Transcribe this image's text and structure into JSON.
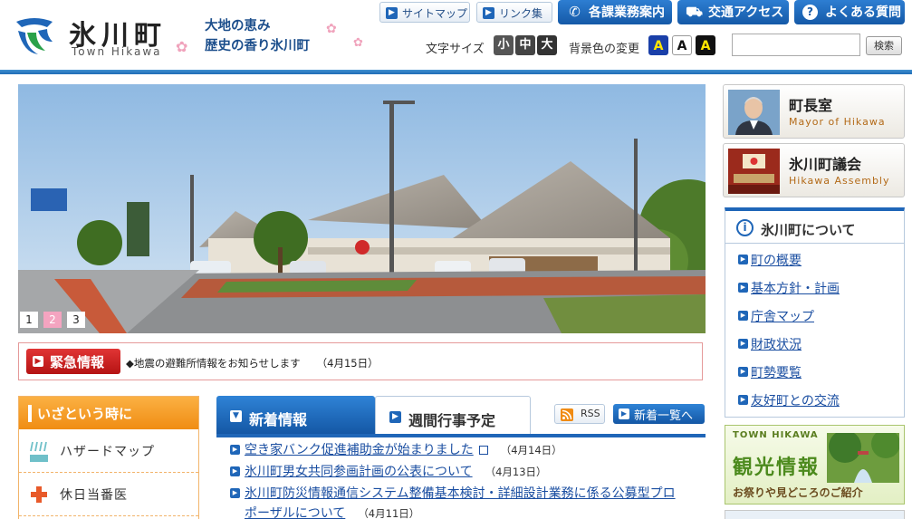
{
  "site": {
    "title": "氷川町",
    "title_en": "Town Hikawa",
    "tagline_1": "大地の恵み",
    "tagline_2": "歴史の香り氷川町"
  },
  "header_links": {
    "sitemap": "サイトマップ",
    "links": "リンク集"
  },
  "top_nav": [
    {
      "label": "各課業務案内",
      "icon": "phone-icon"
    },
    {
      "label": "交通アクセス",
      "icon": "car-icon"
    },
    {
      "label": "よくある質問",
      "icon": "question-icon"
    }
  ],
  "font_size": {
    "label": "文字サイズ",
    "small": "小",
    "medium": "中",
    "large": "大"
  },
  "bg_color": {
    "label": "背景色の変更",
    "options": [
      "A",
      "A",
      "A"
    ]
  },
  "search": {
    "placeholder": "",
    "button": "検索"
  },
  "slideshow": {
    "dots": [
      "1",
      "2",
      "3"
    ],
    "active": 2
  },
  "emergency": {
    "badge": "緊急情報",
    "text": "◆地震の避難所情報をお知らせします",
    "date": "（4月15日）"
  },
  "in_emergency": {
    "title": "いざという時に",
    "items": [
      {
        "label": "ハザードマップ",
        "icon": "rain-icon"
      },
      {
        "label": "休日当番医",
        "icon": "medical-cross-icon"
      }
    ]
  },
  "news": {
    "tab_news": "新着情報",
    "tab_weekly": "週間行事予定",
    "rss": "RSS",
    "list_button": "新着一覧へ",
    "items": [
      {
        "title": "空き家バンク促進補助金が始まりました",
        "date": "（4月14日）",
        "external": true
      },
      {
        "title": "氷川町男女共同参画計画の公表について",
        "date": "（4月13日）",
        "external": false
      },
      {
        "title": "氷川町防災情報通信システム整備基本検討・詳細設計業務に係る公募型プロ",
        "title_cont": "ポーザルについて",
        "date": "（4月11日）",
        "external": false
      }
    ]
  },
  "mayor": {
    "title": "町長室",
    "subtitle": "Mayor of Hikawa"
  },
  "assembly": {
    "title": "氷川町議会",
    "subtitle": "Hikawa Assembly"
  },
  "about": {
    "title": "氷川町について",
    "items": [
      "町の概要",
      "基本方針・計画",
      "庁舎マップ",
      "財政状況",
      "町勢要覧",
      "友好町との交流"
    ]
  },
  "tourism": {
    "small": "TOWN HIKAWA",
    "title": "観光情報",
    "subtitle": "お祭りや見どころのご紹介"
  },
  "colors": {
    "primary": "#1f66b8",
    "accent_orange": "#f08d13",
    "alert_red": "#c31d1d"
  }
}
